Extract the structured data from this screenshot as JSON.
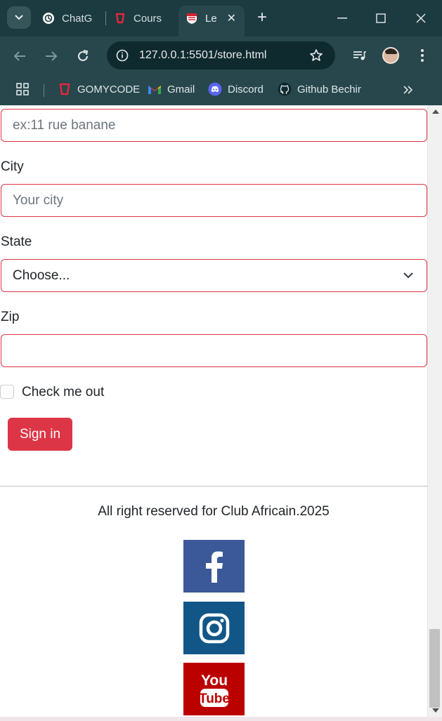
{
  "browser": {
    "tabs": [
      {
        "label": "ChatG"
      },
      {
        "label": "Cours"
      },
      {
        "label": "Le"
      }
    ],
    "url": "127.0.0.1:5501/store.html",
    "bookmarks": [
      {
        "label": "GOMYCODE"
      },
      {
        "label": "Gmail"
      },
      {
        "label": "Discord"
      },
      {
        "label": "Github Bechir"
      }
    ]
  },
  "form": {
    "address": {
      "placeholder": "ex:11 rue banane"
    },
    "city": {
      "label": "City",
      "placeholder": "Your city"
    },
    "state": {
      "label": "State",
      "selected": "Choose..."
    },
    "zip": {
      "label": "Zip",
      "value": ""
    },
    "checkbox_label": "Check me out",
    "submit_label": "Sign in"
  },
  "footer": {
    "text": "All right reserved for Club Africain.2025",
    "social": [
      {
        "name": "facebook-icon",
        "color": "#3b5998"
      },
      {
        "name": "instagram-icon",
        "color": "#125688"
      },
      {
        "name": "youtube-icon",
        "color": "#bb0000",
        "text_top": "You",
        "text_bottom": "Tube"
      }
    ]
  },
  "colors": {
    "accent": "#dc3545",
    "titlebar": "#1c3b40",
    "toolbar": "#27474c"
  }
}
